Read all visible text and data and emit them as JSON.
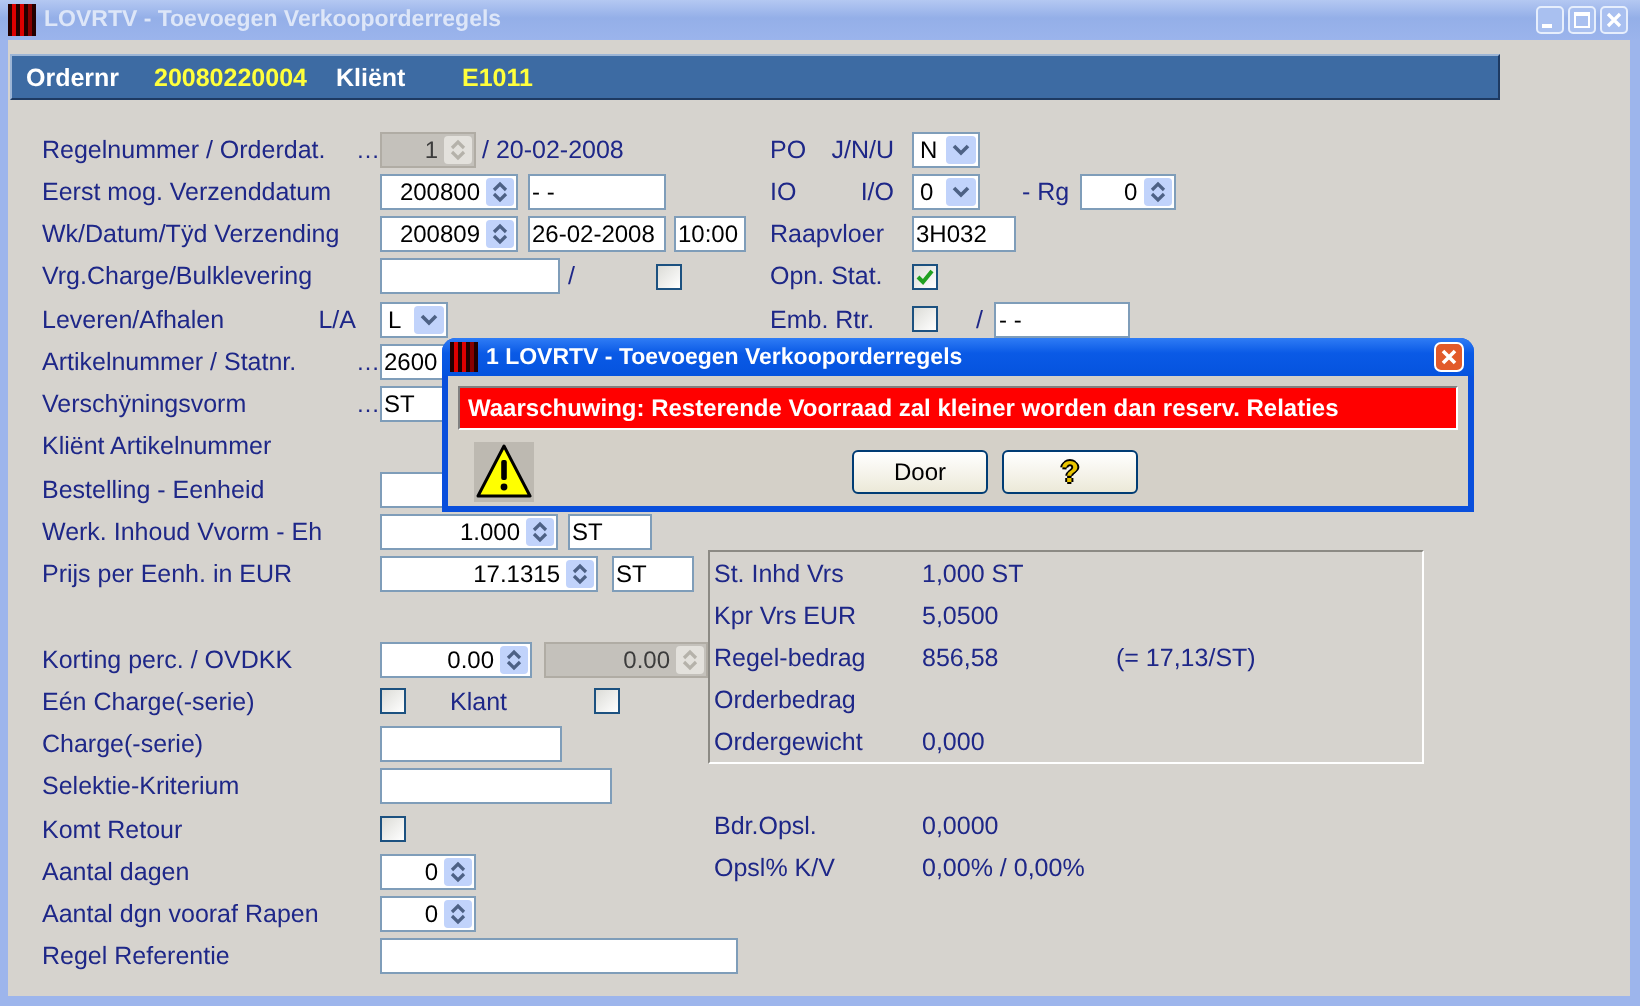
{
  "window": {
    "title": "LOVRTV - Toevoegen Verkooporderregels"
  },
  "header": [
    {
      "kind": "label",
      "text": "Ordernr"
    },
    {
      "kind": "value",
      "text": "20080220004"
    },
    {
      "kind": "label",
      "text": "Kliënt"
    },
    {
      "kind": "value",
      "text": "E1011"
    }
  ],
  "form_left": {
    "groups": [
      {
        "rows": [
          {
            "label": "Regelnummer / Orderdat.",
            "marker": "…",
            "items": [
              {
                "kind": "spin",
                "value": "1",
                "disabled": true
              },
              {
                "kind": "text",
                "text": "/ 20-02-2008"
              }
            ]
          },
          {
            "label": "Eerst mog. Verzenddatum",
            "items": [
              {
                "kind": "spin",
                "value": "200800",
                "disabled": false
              },
              {
                "kind": "field",
                "value": "- -"
              }
            ]
          },
          {
            "label": "Wk/Datum/Tÿd Verzending",
            "items": [
              {
                "kind": "spin",
                "value": "200809",
                "disabled": false
              },
              {
                "kind": "field",
                "value": "26-02-2008"
              },
              {
                "kind": "field",
                "value": "10:00"
              }
            ]
          },
          {
            "label": "Vrg.Charge/Bulklevering",
            "items": [
              {
                "kind": "field"
              },
              {
                "kind": "text",
                "text": "/"
              },
              {
                "kind": "check",
                "checked": false
              }
            ]
          },
          {
            "label": "Leveren/Afhalen",
            "tag": "L/A",
            "items": [
              {
                "kind": "select",
                "value": "L"
              }
            ]
          },
          {
            "label": "Artikelnummer / Statnr.",
            "marker": "…",
            "items": [
              {
                "kind": "field",
                "value": "2600"
              }
            ]
          },
          {
            "label": "Verschÿningsvorm",
            "marker": "…",
            "items": [
              {
                "kind": "field",
                "value": "ST"
              }
            ]
          },
          {
            "label": "Kliënt Artikelnummer"
          },
          {
            "label": "Bestelling - Eenheid",
            "items": [
              {
                "kind": "field"
              }
            ]
          },
          {
            "label": "Werk. Inhoud Vvorm - Eh",
            "items": [
              {
                "kind": "spin",
                "value": "1.000",
                "disabled": false
              },
              {
                "kind": "field",
                "value": "ST"
              }
            ]
          },
          {
            "label": "Prijs per Eenh. in EUR",
            "items": [
              {
                "kind": "spin",
                "value": "17.1315",
                "disabled": false
              },
              {
                "kind": "field",
                "value": "ST"
              }
            ]
          }
        ]
      },
      {
        "rows": [
          {
            "label": "Korting perc. / OVDKK",
            "items": [
              {
                "kind": "spin",
                "value": "0.00",
                "disabled": false
              },
              {
                "kind": "spin",
                "value": "0.00",
                "disabled": true
              }
            ]
          },
          {
            "label": "Eén Charge(-serie)",
            "items": [
              {
                "kind": "check",
                "checked": false
              },
              {
                "kind": "text",
                "text": "Klant"
              },
              {
                "kind": "check",
                "checked": false
              }
            ]
          },
          {
            "label": "Charge(-serie)",
            "items": [
              {
                "kind": "field"
              }
            ]
          },
          {
            "label": "Selektie-Kriterium",
            "items": [
              {
                "kind": "field"
              }
            ]
          },
          {
            "label": "Komt Retour",
            "items": [
              {
                "kind": "check",
                "checked": false
              }
            ]
          },
          {
            "label": "Aantal dagen",
            "items": [
              {
                "kind": "spin",
                "value": "0",
                "disabled": false
              }
            ]
          },
          {
            "label": "Aantal dgn vooraf Rapen",
            "items": [
              {
                "kind": "spin",
                "value": "0",
                "disabled": false
              }
            ]
          },
          {
            "label": "Regel Referentie",
            "items": [
              {
                "kind": "field"
              }
            ]
          }
        ]
      }
    ]
  },
  "form_right": {
    "rows": [
      {
        "label": "PO",
        "tag": "J/N/U",
        "items": [
          {
            "kind": "select",
            "value": "N"
          }
        ]
      },
      {
        "label": "IO",
        "tag": "I/O",
        "items": [
          {
            "kind": "select",
            "value": "0"
          },
          {
            "kind": "text",
            "text": "- Rg"
          },
          {
            "kind": "spin",
            "value": "0",
            "disabled": false
          }
        ]
      },
      {
        "label": "Raapvloer",
        "items": [
          {
            "kind": "field",
            "value": "3H032"
          }
        ]
      },
      {
        "label": "Opn. Stat.",
        "items": [
          {
            "kind": "check",
            "checked": true
          }
        ]
      },
      {
        "label": "Emb. Rtr.",
        "items": [
          {
            "kind": "check",
            "checked": false
          },
          {
            "kind": "text",
            "text": "/"
          },
          {
            "kind": "field",
            "value": "- -"
          }
        ]
      }
    ]
  },
  "summary": {
    "rows": [
      {
        "label": "St. Inhd Vrs",
        "value": "1,000 ST"
      },
      {
        "label": "Kpr Vrs  EUR",
        "value": "5,0500"
      },
      {
        "label": "Regel-bedrag",
        "value": "856,58",
        "note": "(=  17,13/ST)"
      },
      {
        "label": "Orderbedrag"
      },
      {
        "label": "Ordergewicht",
        "value": "0,000"
      }
    ]
  },
  "markup": [
    {
      "label": "Bdr.Opsl.",
      "value": "0,0000"
    },
    {
      "label": "Opsl% K/V",
      "value": "0,00% / 0,00%"
    }
  ],
  "dialog": {
    "title": "1 LOVRTV - Toevoegen Verkooporderregels",
    "message": "Waarschuwing: Resterende Voorraad zal kleiner worden dan reserv. Relaties",
    "buttons": [
      {
        "kind": "text",
        "label": "Door"
      },
      {
        "kind": "help",
        "label": "?"
      }
    ]
  }
}
